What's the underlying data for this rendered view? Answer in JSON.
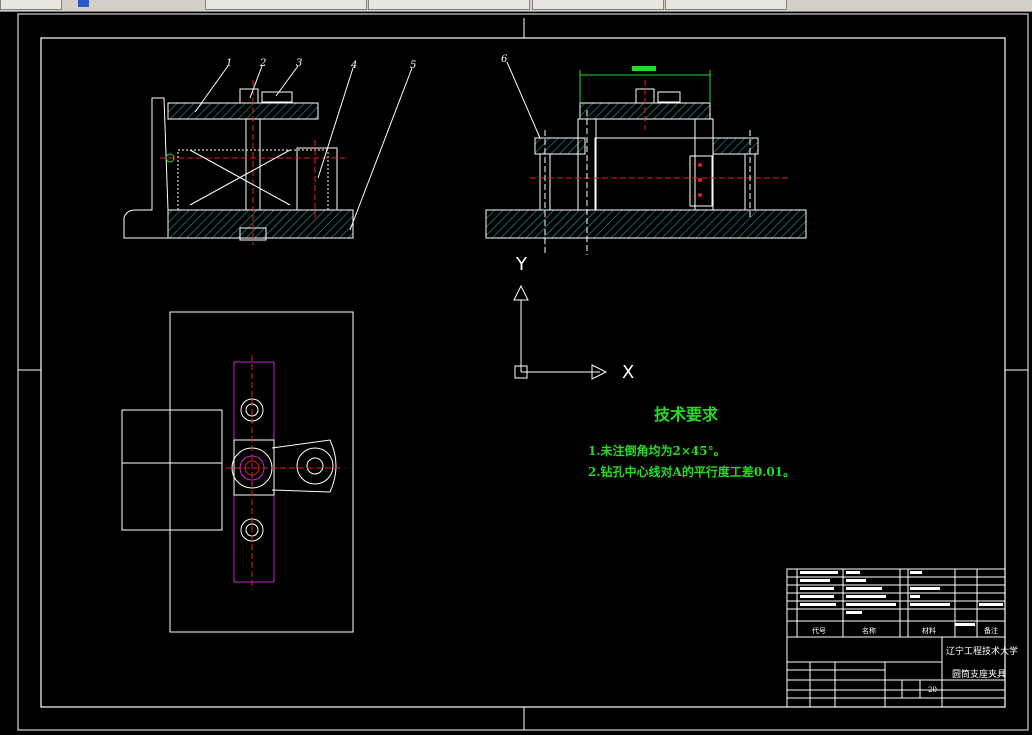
{
  "title_block": {
    "university": "辽宁工程技术大学",
    "drawing_name": "圆筒支座夹具",
    "header_code": "代号",
    "header_name": "名称",
    "header_material": "材料",
    "header_remark": "备注",
    "scale_value": "20"
  },
  "tech_requirements": {
    "title": "技术要求",
    "items": [
      "1.未注倒角均为2×45°。",
      "2.钻孔中心线对A的平行度工差0.01。"
    ]
  },
  "part_labels": [
    "1",
    "2",
    "3",
    "4",
    "5",
    "6"
  ],
  "ucs": {
    "y_label": "Y",
    "x_label": "X"
  },
  "colors": {
    "background": "#000000",
    "lines": "#ffffff",
    "hatch": "#1fa39a",
    "center": "#e02020",
    "text_green": "#22dd22",
    "magenta": "#d020d0"
  }
}
